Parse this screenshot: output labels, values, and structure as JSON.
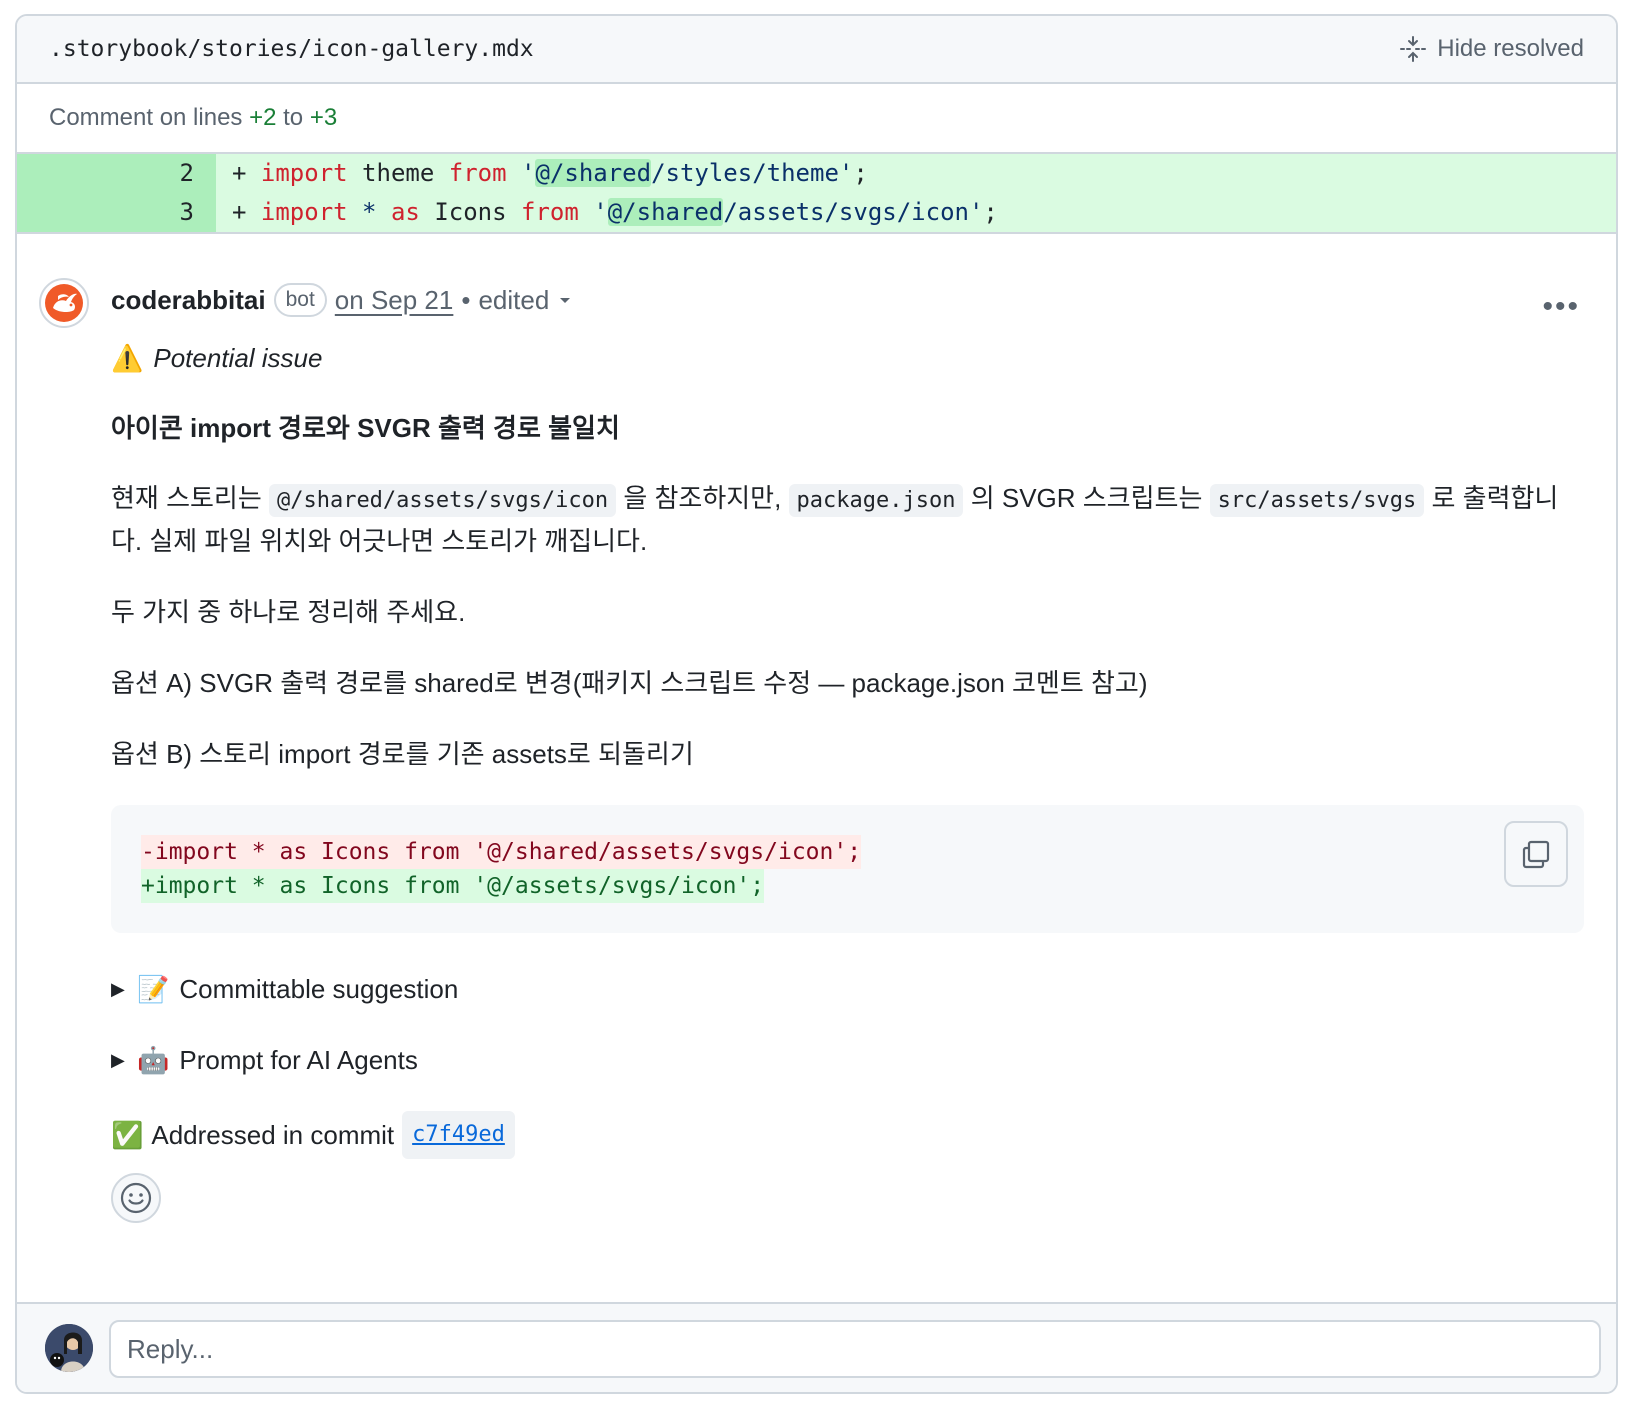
{
  "file": {
    "path": ".storybook/stories/icon-gallery.mdx",
    "hide_resolved_label": "Hide resolved",
    "hide_resolved_icon": "fold-icon"
  },
  "comment_lines": {
    "prefix": "Comment on lines",
    "from": "+2",
    "to_word": "to",
    "to": "+3"
  },
  "diff": {
    "lines": [
      {
        "number": "2",
        "marker": "+",
        "t1": "import",
        "t2": " theme ",
        "t3": "from",
        "t4": " '",
        "t5": "@/shared",
        "t6": "/styles/theme'",
        "t7": ";"
      },
      {
        "number": "3",
        "marker": "+",
        "t1": "import",
        "t2": " * ",
        "t3": "as",
        "t4": " Icons ",
        "t5": "from",
        "t6": " '",
        "t7": "@/shared",
        "t8": "/assets/svgs/icon'",
        "t9": ";"
      }
    ]
  },
  "comment": {
    "author": "coderabbitai",
    "badge": "bot",
    "date": "on Sep 21",
    "separator": "•",
    "edited": "edited",
    "more_icon": "kebab-horizontal-icon",
    "more_label": "•••",
    "issue": {
      "emoji": "⚠️",
      "label": "Potential issue"
    },
    "heading": "아이콘 import 경로와 SVGR 출력 경로 불일치",
    "para1": {
      "a": "현재 스토리는 ",
      "code1": "@/shared/assets/svgs/icon",
      "b": " 을 참조하지만, ",
      "code2": "package.json",
      "c": " 의 SVGR 스크립트는 ",
      "code3": "src/assets/svgs",
      "d": " 로 출력합니다. 실제 파일 위치와 어긋나면 스토리가 깨집니다."
    },
    "para2": "두 가지 중 하나로 정리해 주세요.",
    "option_a": "옵션 A) SVGR 출력 경로를 shared로 변경(패키지 스크립트 수정 — package.json 코멘트 참고)",
    "option_b": "옵션 B) 스토리 import 경로를 기존 assets로 되돌리기",
    "code": {
      "removed": "-import * as Icons from '@/shared/assets/svgs/icon';",
      "added": "+import * as Icons from '@/assets/svgs/icon';",
      "copy_icon": "copy-icon"
    },
    "details": [
      {
        "arrow": "▶",
        "emoji": "📝",
        "label": "Committable suggestion"
      },
      {
        "arrow": "▶",
        "emoji": "🤖",
        "label": "Prompt for AI Agents"
      }
    ],
    "addressed": {
      "emoji": "✅",
      "label": "Addressed in commit",
      "commit": "c7f49ed"
    },
    "reaction_icon": "smiley-icon"
  },
  "reply": {
    "placeholder": "Reply..."
  },
  "colors": {
    "addition_line_number_bg": "#aceebb",
    "addition_bg": "#dafbe1",
    "keyword": "#cf222e",
    "string": "#0a3069",
    "link": "#0969da",
    "muted": "#59636e",
    "border": "#d0d7de",
    "brand_orange": "#f05a28"
  }
}
